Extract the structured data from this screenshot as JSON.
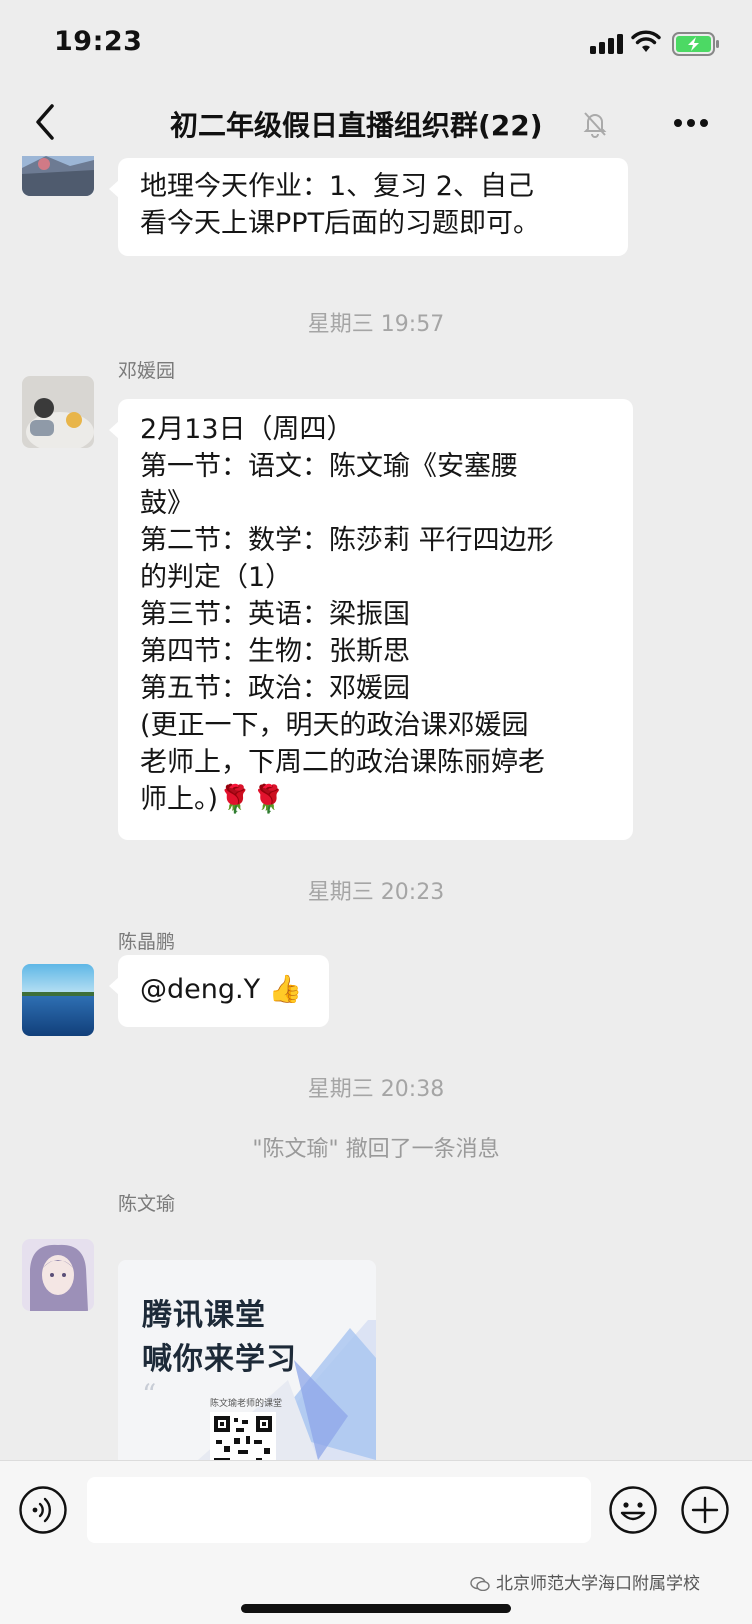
{
  "status_bar": {
    "time": "19:23"
  },
  "header": {
    "title": "初二年级假日直播组织群(22)"
  },
  "messages": [
    {
      "lines": [
        "地理今天作业：1、复习 2、自己",
        "看今天上课PPT后面的习题即可。"
      ]
    },
    {
      "sender": "邓媛园",
      "lines": [
        "2月13日（周四）",
        "第一节：语文：陈文瑜《安塞腰",
        "鼓》",
        "第二节：数学：陈莎莉 平行四边形",
        "的判定（1）",
        "第三节：英语：梁振国",
        "第四节：生物：张斯思",
        "第五节：政治：邓媛园",
        "(更正一下，明天的政治课邓媛园",
        "老师上，下周二的政治课陈丽婷老",
        "师上。)🌹🌹"
      ]
    },
    {
      "sender": "陈晶鹏",
      "text": "@deng.Y 👍"
    },
    {
      "sender": "陈文瑜"
    }
  ],
  "timestamps": [
    "星期三 19:57",
    "星期三 20:23",
    "星期三 20:38"
  ],
  "recall_notice": "\"陈文瑜\" 撤回了一条消息",
  "card": {
    "line1": "腾讯课堂",
    "line2": "喊你来学习",
    "subtitle": "陈文瑜老师的课堂"
  },
  "watermark": "北京师范大学海口附属学校",
  "icons": {
    "back": "chevron-left-icon",
    "mute": "bell-muted-icon",
    "more": "more-dots-icon",
    "voice": "voice-icon",
    "emoji": "emoji-icon",
    "plus": "plus-icon"
  },
  "colors": {
    "background": "#ededed",
    "bubble": "#ffffff",
    "battery": "#4cd964"
  }
}
